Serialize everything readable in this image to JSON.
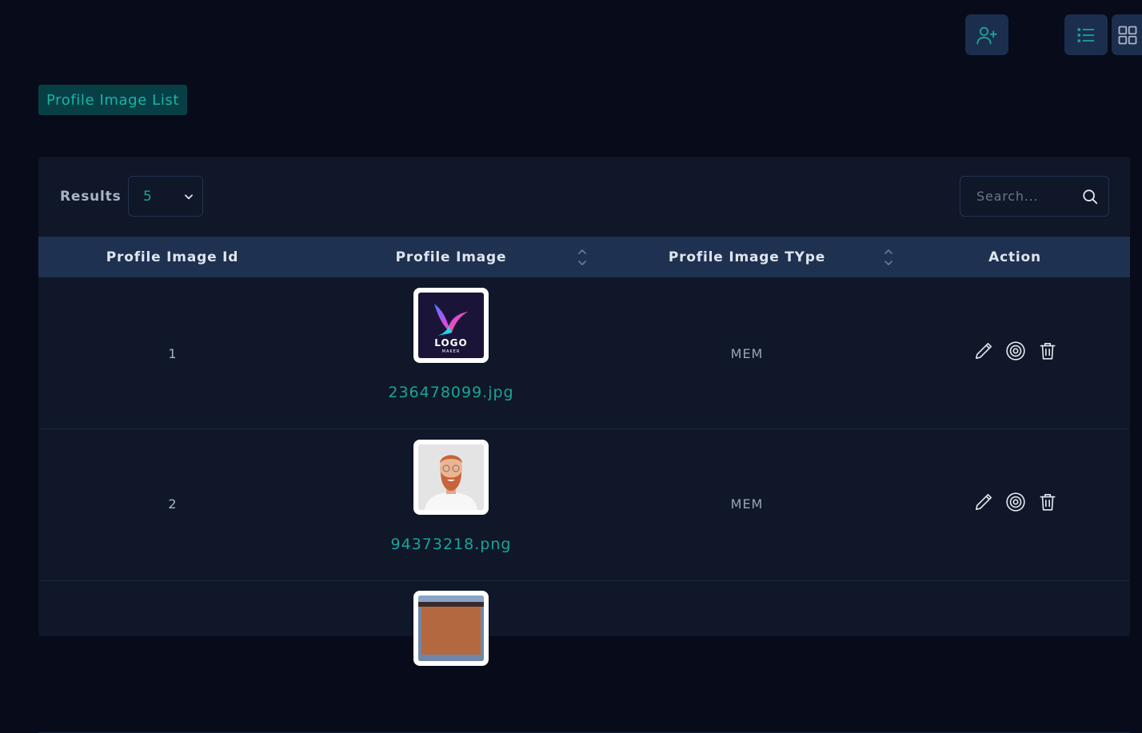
{
  "header": {
    "add_user_icon": "user-plus-icon",
    "list_view_icon": "list-icon",
    "grid_view_icon": "grid-icon"
  },
  "page": {
    "title": "Profile Image List"
  },
  "toolbar": {
    "results_label": "Results :",
    "results_value": "5",
    "search_placeholder": "Search..."
  },
  "table": {
    "columns": [
      "Profile Image Id",
      "Profile Image",
      "Profile Image TYpe",
      "Action"
    ],
    "rows": [
      {
        "id": "1",
        "filename": "236478099.jpg",
        "type": "MEM"
      },
      {
        "id": "2",
        "filename": "94373218.png",
        "type": "MEM"
      },
      {
        "id": "",
        "filename": "",
        "type": ""
      }
    ],
    "logo_text": "LOGO",
    "logo_subtext": "MAKER"
  },
  "colors": {
    "accent": "#1aa596",
    "background": "#070b1a",
    "card": "#0f1729",
    "header_row": "#1e3150"
  }
}
